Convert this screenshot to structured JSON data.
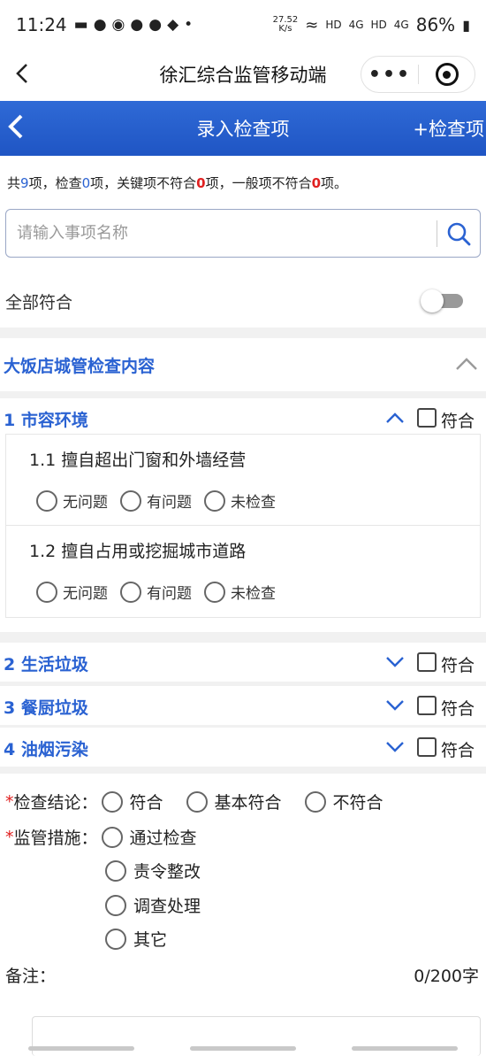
{
  "status": {
    "time": "11:24",
    "net_speed_value": "27.52",
    "net_speed_unit": "K/s",
    "hd1": "HD",
    "sig1": "4G",
    "hd2": "HD",
    "sig2": "4G",
    "battery": "86%"
  },
  "miniprogram": {
    "title": "徐汇综合监管移动端",
    "more_label": "•••"
  },
  "page": {
    "title": "录入检查项",
    "add_label": "+检查项"
  },
  "summary": {
    "p1": "共",
    "total": "9",
    "p2": "项，检查",
    "checked": "0",
    "p3": "项，关键项不符合",
    "key_fail": "0",
    "p4": "项，一般项不符合",
    "general_fail": "0",
    "p5": "项。"
  },
  "search": {
    "placeholder": "请输入事项名称"
  },
  "all_conform": {
    "label": "全部符合",
    "on": false
  },
  "section": {
    "title": "大饭店城管检查内容"
  },
  "categories": [
    {
      "name": "1 市容环境",
      "conform_label": "符合",
      "expanded": true
    },
    {
      "name": "2 生活垃圾",
      "conform_label": "符合",
      "expanded": false
    },
    {
      "name": "3 餐厨垃圾",
      "conform_label": "符合",
      "expanded": false
    },
    {
      "name": "4 油烟污染",
      "conform_label": "符合",
      "expanded": false
    }
  ],
  "items": [
    {
      "title": "1.1  擅自超出门窗和外墙经营",
      "options": [
        "无问题",
        "有问题",
        "未检查"
      ]
    },
    {
      "title": "1.2  擅自占用或挖掘城市道路",
      "options": [
        "无问题",
        "有问题",
        "未检查"
      ]
    }
  ],
  "form": {
    "required_mark": "*",
    "conclusion_label": "检查结论：",
    "conclusion_options": [
      "符合",
      "基本符合",
      "不符合"
    ],
    "measures_label": "监管措施：",
    "measures_options": [
      "通过检查",
      "责令整改",
      "调查处理",
      "其它"
    ],
    "remark_label": "备注：",
    "remark_count": "0/200字"
  },
  "colors": {
    "brand_blue": "#2a62d2",
    "header_blue": "#1f55c4",
    "alert_red": "#e02020"
  }
}
